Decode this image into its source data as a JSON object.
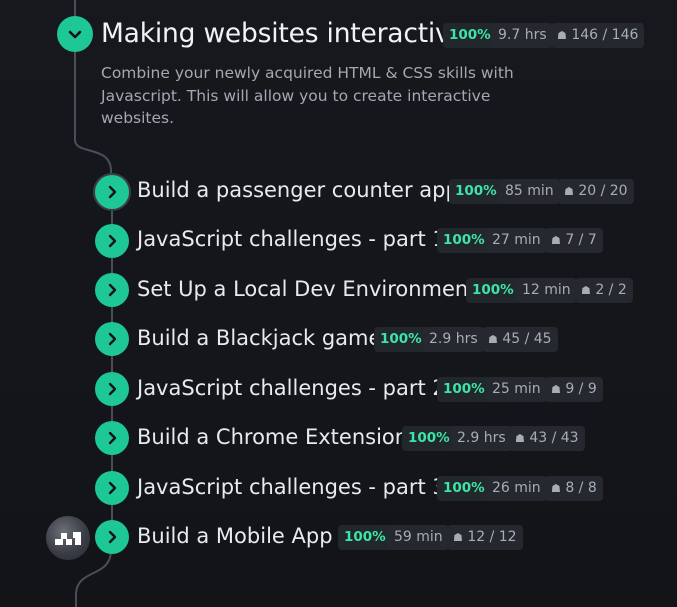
{
  "section": {
    "title": "Making websites interactive",
    "percent": "100%",
    "duration": "9.7 hrs",
    "count": "146 / 146",
    "description": "Combine your newly acquired HTML & CSS skills with Javascript. This will allow you to create interactive websites."
  },
  "lessons": [
    {
      "title": "Build a passenger counter app",
      "percent": "100%",
      "duration": "85 min",
      "count": "20 / 20"
    },
    {
      "title": "JavaScript challenges - part 1",
      "percent": "100%",
      "duration": "27 min",
      "count": "7 / 7"
    },
    {
      "title": "Set Up a Local Dev Environment",
      "percent": "100%",
      "duration": "12 min",
      "count": "2 / 2"
    },
    {
      "title": "Build a Blackjack game",
      "percent": "100%",
      "duration": "2.9 hrs",
      "count": "45 / 45"
    },
    {
      "title": "JavaScript challenges - part 2",
      "percent": "100%",
      "duration": "25 min",
      "count": "9 / 9"
    },
    {
      "title": "Build a Chrome Extension",
      "percent": "100%",
      "duration": "2.9 hrs",
      "count": "43 / 43"
    },
    {
      "title": "JavaScript challenges - part 3",
      "percent": "100%",
      "duration": "26 min",
      "count": "8 / 8"
    },
    {
      "title": "Build a Mobile App",
      "percent": "100%",
      "duration": "59 min",
      "count": "12 / 12"
    }
  ],
  "icons": {
    "chevron": "chevron-down-icon",
    "lesson": "chevron-right-icon",
    "count": "ghost-icon"
  },
  "colors": {
    "accent": "#1ec796",
    "percent": "#3ee3a8"
  }
}
